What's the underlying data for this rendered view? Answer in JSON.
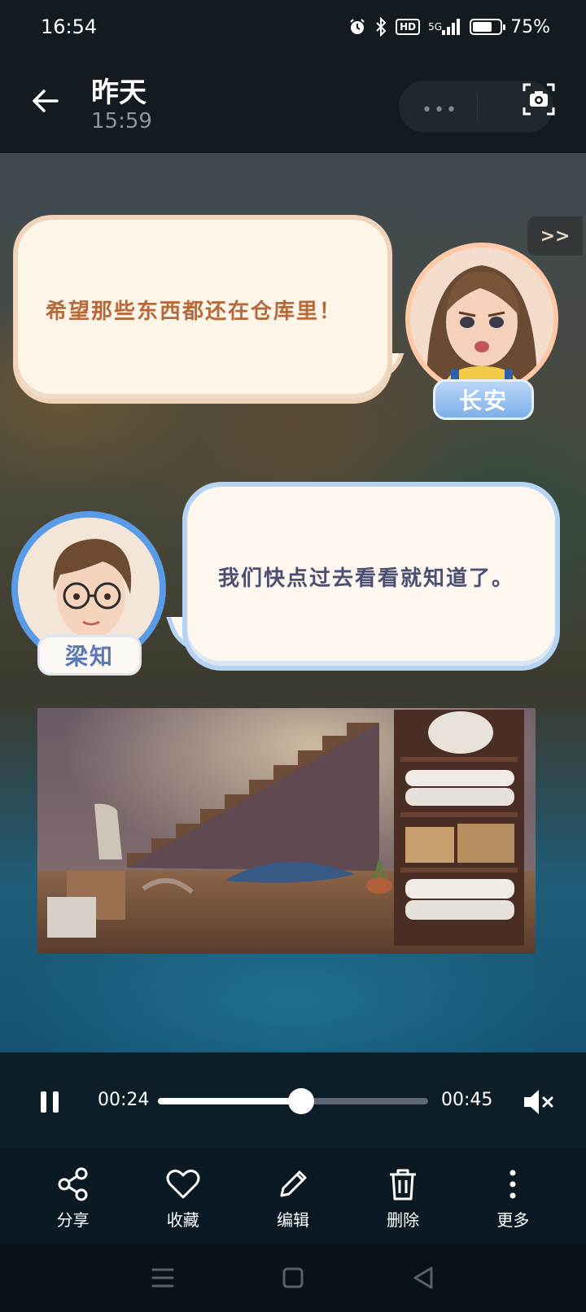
{
  "status_bar": {
    "time": "16:54",
    "battery_percent": "75%",
    "battery_level": 0.75,
    "icons": [
      "alarm-icon",
      "bluetooth-icon",
      "hd-icon",
      "5g-signal-icon",
      "battery-icon"
    ],
    "hd_label": "HD",
    "network_label": "5G"
  },
  "header": {
    "title": "昨天",
    "subtitle": "15:59",
    "capsule_dots": "•••"
  },
  "video": {
    "skip_label": ">>",
    "dialogue": [
      {
        "speaker": "长安",
        "text": "希望那些东西都还在仓库里！"
      },
      {
        "speaker": "梁知",
        "text": "我们快点过去看看就知道了。"
      }
    ]
  },
  "playback": {
    "current_time": "00:24",
    "total_time": "00:45",
    "progress": 0.53
  },
  "actions": [
    {
      "label": "分享",
      "icon": "share-icon"
    },
    {
      "label": "收藏",
      "icon": "heart-icon"
    },
    {
      "label": "编辑",
      "icon": "pencil-icon"
    },
    {
      "label": "删除",
      "icon": "trash-icon"
    },
    {
      "label": "更多",
      "icon": "more-vertical-icon"
    }
  ],
  "nav": [
    "menu-icon",
    "home-square-icon",
    "back-triangle-icon"
  ],
  "colors": {
    "bubble_text_orange": "#b66a3c",
    "bubble_text_blue": "#4b4f72",
    "nametag_blue": "#7eb0ea"
  }
}
